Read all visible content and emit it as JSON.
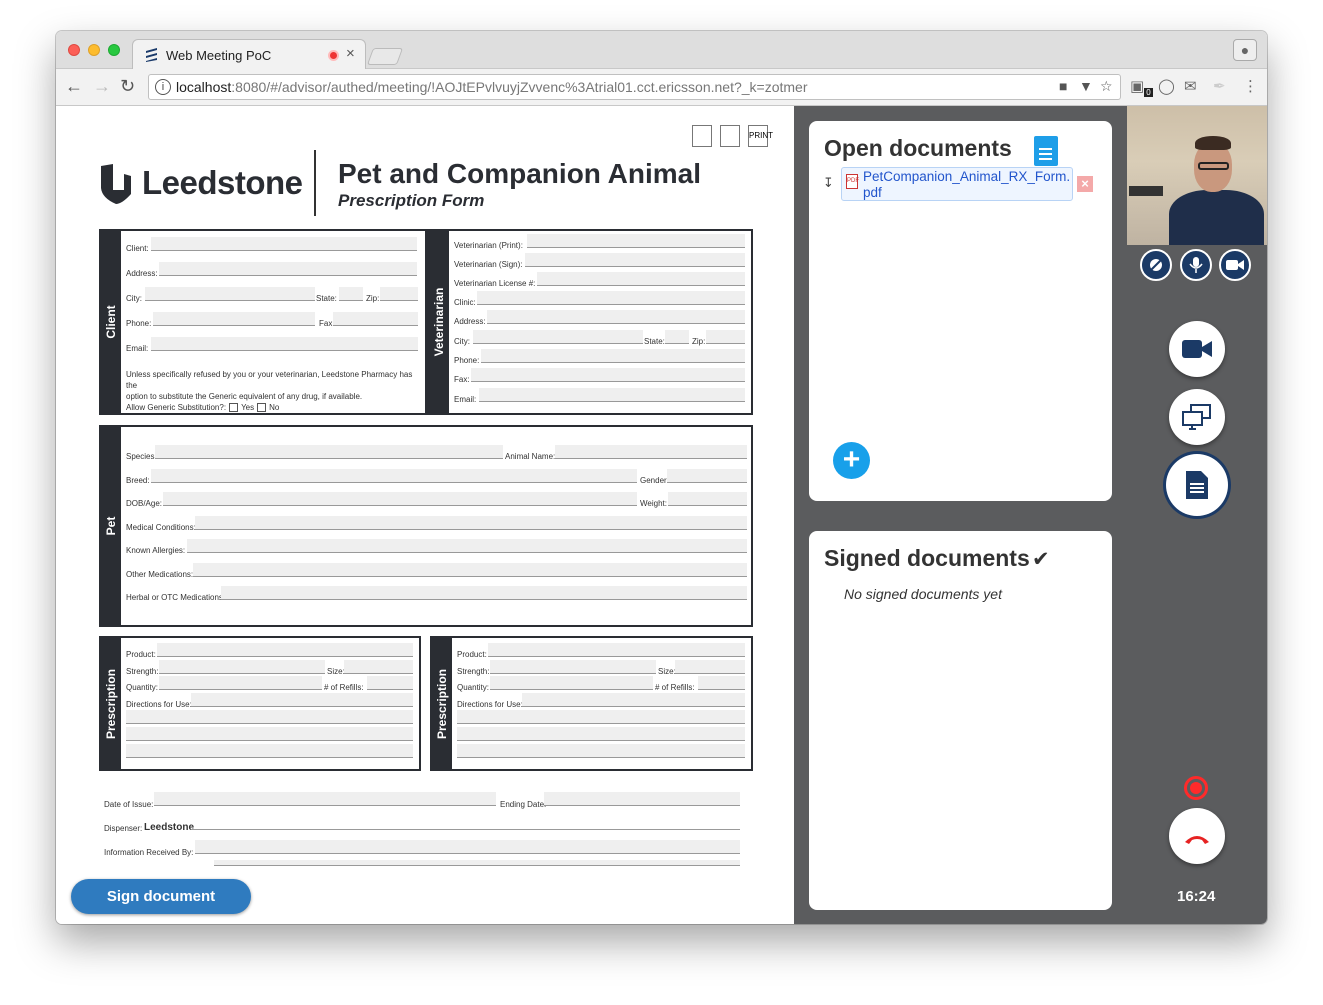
{
  "browser": {
    "tab_title": "Web Meeting PoC",
    "tab_close": "×",
    "url_host": "localhost",
    "url_rest": ":8080/#/advisor/authed/meeting/!AOJtEPvlvuyjZvvenc%3Atrial01.cct.ericsson.net?_k=zotmer",
    "info_icon": "i",
    "extension_badge": "0"
  },
  "form": {
    "brand": "Leedstone",
    "title": "Pet and Companion Animal",
    "subtitle": "Prescription Form",
    "viewer_print": "PRINT",
    "client": {
      "section": "Client",
      "client": "Client:",
      "address": "Address:",
      "city": "City:",
      "state": "State:",
      "zip": "Zip:",
      "phone": "Phone:",
      "fax": "Fax:",
      "email": "Email:",
      "note1": "Unless specifically refused by you or your veterinarian, Leedstone Pharmacy has the",
      "note2": "option to substitute the Generic equivalent of any drug, if available.",
      "generic": "Allow Generic Substitution?:",
      "yes": "Yes",
      "no": "No"
    },
    "vet": {
      "section": "Veterinarian",
      "print": "Veterinarian (Print):",
      "sign": "Veterinarian (Sign):",
      "license": "Veterinarian License #:",
      "clinic": "Clinic:",
      "address": "Address:",
      "city": "City:",
      "state": "State:",
      "zip": "Zip:",
      "phone": "Phone:",
      "fax": "Fax:",
      "email": "Email:"
    },
    "pet": {
      "section": "Pet",
      "species": "Species:",
      "animal_name": "Animal Name:",
      "breed": "Breed:",
      "gender": "Gender:",
      "dob": "DOB/Age:",
      "weight": "Weight:",
      "conditions": "Medical Conditions:",
      "allergies": "Known Allergies:",
      "other": "Other Medications:",
      "herbal": "Herbal or OTC Medications:"
    },
    "rx": {
      "section": "Prescription",
      "product": "Product:",
      "strength": "Strength:",
      "size": "Size:",
      "quantity": "Quantity:",
      "refills": "# of Refills:",
      "directions": "Directions for Use:"
    },
    "footer": {
      "date_issue": "Date of Issue:",
      "ending_date": "Ending Date:",
      "dispenser": "Dispenser:",
      "dispenser_value": "Leedstone",
      "info_received": "Information Received By:"
    }
  },
  "sign_button": "Sign document",
  "open_documents": {
    "title": "Open documents",
    "file_name": "PetCompanion_Animal_RX_Form.pdf",
    "pdf_badge": "PDF",
    "remove": "×",
    "add": "+"
  },
  "signed_documents": {
    "title": "Signed documents",
    "check": "✔",
    "empty": "No signed documents yet"
  },
  "call": {
    "time": "16:24"
  }
}
